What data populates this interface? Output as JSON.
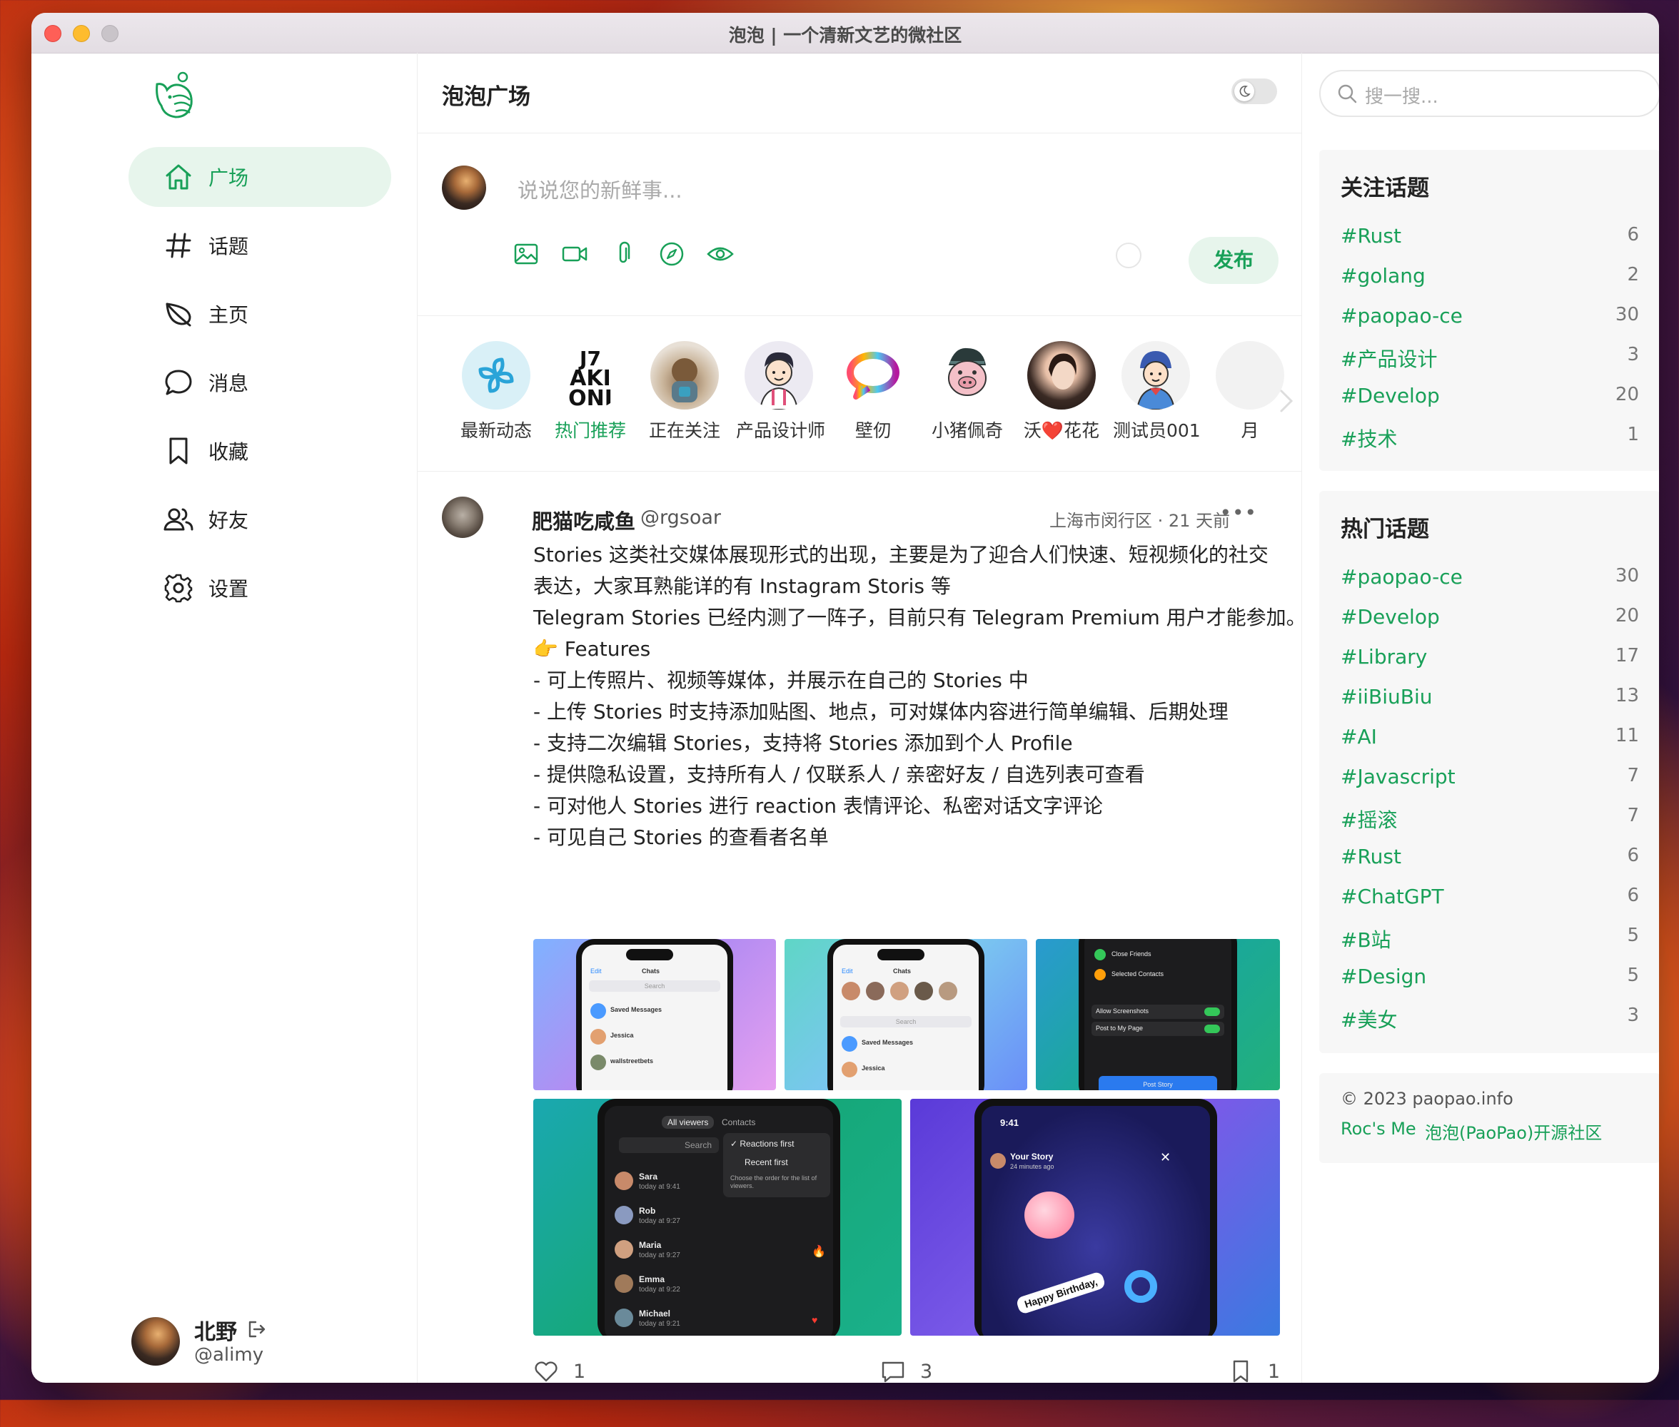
{
  "window": {
    "title": "泡泡 | 一个清新文艺的微社区"
  },
  "sidebar": {
    "items": [
      {
        "label": "广场",
        "icon": "home-icon",
        "active": true
      },
      {
        "label": "话题",
        "icon": "hash-icon"
      },
      {
        "label": "主页",
        "icon": "leaf-icon"
      },
      {
        "label": "消息",
        "icon": "chat-icon"
      },
      {
        "label": "收藏",
        "icon": "bookmark-icon"
      },
      {
        "label": "好友",
        "icon": "users-icon"
      },
      {
        "label": "设置",
        "icon": "gear-icon"
      }
    ],
    "user": {
      "name": "北野",
      "handle": "@alimy"
    }
  },
  "main": {
    "title": "泡泡广场",
    "composer": {
      "placeholder": "说说您的新鲜事...",
      "publish_label": "发布"
    },
    "stories": [
      {
        "label": "最新动态",
        "highlight": false
      },
      {
        "label": "热门推荐",
        "highlight": true
      },
      {
        "label": "正在关注",
        "highlight": false
      },
      {
        "label": "产品设计师",
        "highlight": false
      },
      {
        "label": "壁仞",
        "highlight": false
      },
      {
        "label": "小猪佩奇",
        "highlight": false
      },
      {
        "label": "沃❤️花花",
        "highlight": false
      },
      {
        "label": "测试员001",
        "highlight": false
      },
      {
        "label": "月",
        "highlight": false
      }
    ],
    "post": {
      "author": "肥猫吃咸鱼",
      "handle": "@rgsoar",
      "meta": "上海市闵行区 · 21 天前",
      "lines": [
        "Stories 这类社交媒体展现形式的出现，主要是为了迎合人们快速、短视频化的社交",
        "表达，大家耳熟能详的有 Instagram Storis 等",
        "Telegram Stories 已经内测了一阵子，目前只有 Telegram Premium 用户才能参加。",
        "👉 Features",
        "- 可上传照片、视频等媒体，并展示在自己的 Stories 中",
        "- 上传 Stories 时支持添加贴图、地点，可对媒体内容进行简单编辑、后期处理",
        "- 支持二次编辑 Stories，支持将 Stories 添加到个人 Profile",
        "- 提供隐私设置，支持所有人 / 仅联系人 / 亲密好友 / 自选列表可查看",
        "- 可对他人 Stories 进行 reaction 表情评论、私密对话文字评论",
        "- 可见自己 Stories 的查看者名单"
      ],
      "images": {
        "img1": {
          "edit": "Edit",
          "chats": "Chats",
          "search": "Search",
          "row1": "Saved Messages",
          "row2": "Jessica",
          "row3": "wallstreetbets"
        },
        "img2": {
          "edit": "Edit",
          "chats": "Chats",
          "search": "Search",
          "row1": "Saved Messages",
          "row2": "Jessica"
        },
        "img3": {
          "row1": "Close Friends",
          "row2": "Selected Contacts",
          "row3": "Allow Screenshots",
          "row4": "Post to My Page",
          "button": "Post Story"
        },
        "img4": {
          "tab1": "All viewers",
          "tab2": "Contacts",
          "search": "Search",
          "menu1": "✓ Reactions first",
          "menu2": "Recent first",
          "menu_hint": "Choose the order for the list of viewers.",
          "viewers": [
            {
              "name": "Sara",
              "time": "today at 9:41"
            },
            {
              "name": "Rob",
              "time": "today at 9:27"
            },
            {
              "name": "Maria",
              "time": "today at 9:27"
            },
            {
              "name": "Emma",
              "time": "today at 9:22"
            },
            {
              "name": "Michael",
              "time": "today at 9:21"
            }
          ]
        },
        "img5": {
          "clock": "9:41",
          "story_title": "Your Story",
          "story_sub": "24 minutes ago",
          "sticker": "Happy Birthday,"
        }
      },
      "likes": "1",
      "comments": "3",
      "collects": "1"
    }
  },
  "right": {
    "search_placeholder": "搜一搜...",
    "follow_title": "关注话题",
    "follow_topics": [
      {
        "tag": "#Rust",
        "count": "6"
      },
      {
        "tag": "#golang",
        "count": "2"
      },
      {
        "tag": "#paopao-ce",
        "count": "30"
      },
      {
        "tag": "#产品设计",
        "count": "3"
      },
      {
        "tag": "#Develop",
        "count": "20"
      },
      {
        "tag": "#技术",
        "count": "1"
      }
    ],
    "hot_title": "热门话题",
    "hot_topics": [
      {
        "tag": "#paopao-ce",
        "count": "30"
      },
      {
        "tag": "#Develop",
        "count": "20"
      },
      {
        "tag": "#Library",
        "count": "17"
      },
      {
        "tag": "#iiBiuBiu",
        "count": "13"
      },
      {
        "tag": "#AI",
        "count": "11"
      },
      {
        "tag": "#Javascript",
        "count": "7"
      },
      {
        "tag": "#摇滚",
        "count": "7"
      },
      {
        "tag": "#Rust",
        "count": "6"
      },
      {
        "tag": "#ChatGPT",
        "count": "6"
      },
      {
        "tag": "#B站",
        "count": "5"
      },
      {
        "tag": "#Design",
        "count": "5"
      },
      {
        "tag": "#美女",
        "count": "3"
      }
    ],
    "footer": {
      "copyright": "© 2023 paopao.info",
      "link1": "Roc's Me",
      "link2": "泡泡(PaoPao)开源社区"
    }
  },
  "colors": {
    "accent": "#18a058",
    "accent_bg": "#e7f5ec"
  }
}
